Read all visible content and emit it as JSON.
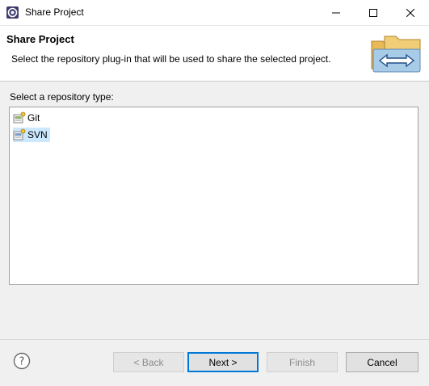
{
  "window": {
    "title": "Share Project",
    "controls": {
      "minimize": "minimize-icon",
      "maximize": "maximize-icon",
      "close": "close-icon"
    }
  },
  "header": {
    "title": "Share Project",
    "description": "Select the repository plug-in that will be used to share the selected project."
  },
  "list": {
    "label": "Select a repository type:",
    "items": [
      {
        "label": "Git",
        "icon": "git-repository-icon",
        "selected": false
      },
      {
        "label": "SVN",
        "icon": "svn-repository-icon",
        "selected": true
      }
    ]
  },
  "buttons": {
    "back": "< Back",
    "next": "Next >",
    "finish": "Finish",
    "cancel": "Cancel"
  },
  "colors": {
    "selection": "#cce8ff",
    "default_button_border": "#0078d7"
  }
}
